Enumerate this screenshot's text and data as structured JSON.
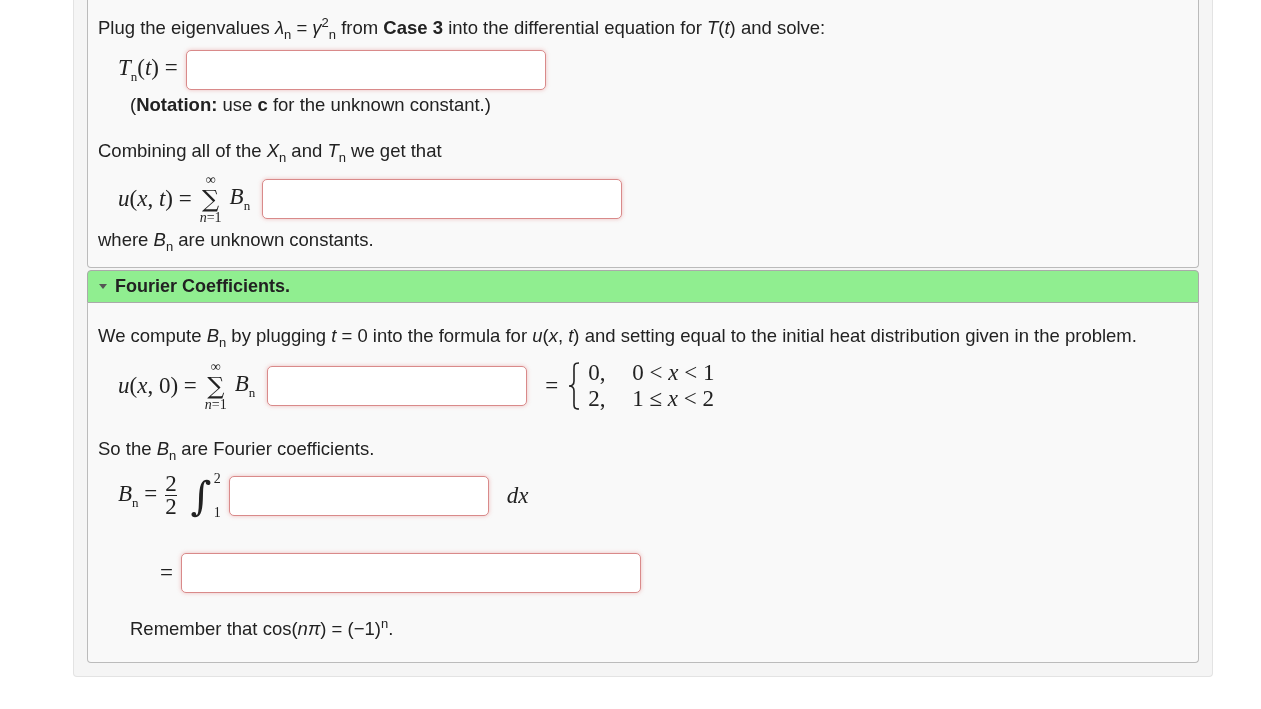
{
  "solution_section": {
    "blocks": [
      {
        "kind": "text",
        "text": "Plug the eigenvalues *λ*$_{n}$ = *γ*$^{2}$$_{n}$ from **Case 3** into the differential equation for *T*(*t*) and solve:"
      },
      {
        "kind": "equation",
        "lhs": "*T*$_{n}$(*t*) ="
      },
      {
        "kind": "note",
        "text": "(**Notation:** use **c** for the unknown constant.)"
      },
      {
        "kind": "text",
        "text": "Combining all of the *X*$_{n}$ and *T*$_{n}$ we get that"
      },
      {
        "kind": "sum",
        "lhs": "*u*(*x*, *t*) =",
        "sigma": "∑",
        "upper": "∞",
        "lower": "*n*=1",
        "coef": "*B*$_{n}$"
      },
      {
        "kind": "text",
        "text": "where *B*$_{n}$ are unknown constants."
      }
    ]
  },
  "fourier_section": {
    "title": "Fourier Coefficients.",
    "expanded": true,
    "blocks": [
      {
        "kind": "text",
        "text": "We compute *B*$_{n}$ by plugging *t* = 0 into the formula for *u*(*x*, *t*) and setting equal to the initial heat distribution given in the problem."
      },
      {
        "kind": "sum",
        "lhs": "*u*(*x*, 0) =",
        "sigma": "∑",
        "upper": "∞",
        "lower": "*n*=1",
        "coef": "*B*$_{n}$",
        "rhs": "=",
        "cases": [
          {
            "value": "0,",
            "condition": "0 < *x* < 1"
          },
          {
            "value": "2,",
            "condition": "1 ≤ *x* < 2"
          }
        ]
      },
      {
        "kind": "text",
        "text": "So the *B*$_{n}$ are Fourier coefficients."
      },
      {
        "kind": "integral",
        "lhs": "*B*$_{n}$ =",
        "numerator": "2",
        "denominator": "2",
        "sign": "∫",
        "upper": "2",
        "lower": "1",
        "after": "*dx*"
      },
      {
        "kind": "continuation",
        "lhs": "="
      },
      {
        "kind": "note",
        "text": "Remember that cos(*nπ*) = (−1)$^{n}$."
      }
    ]
  }
}
